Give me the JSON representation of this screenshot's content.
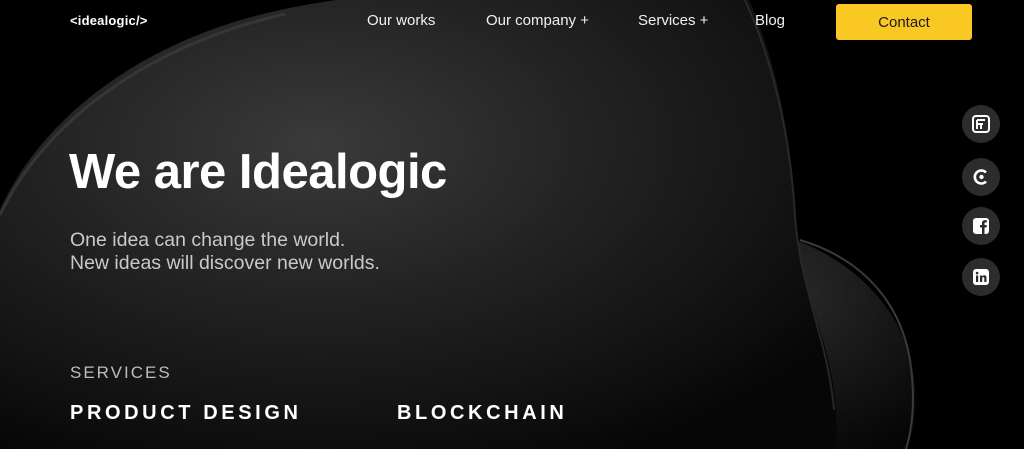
{
  "header": {
    "logo": "<idealogic/>",
    "nav": [
      {
        "label": "Our works"
      },
      {
        "label": "Our company +"
      },
      {
        "label": "Services +"
      },
      {
        "label": "Blog"
      }
    ],
    "contact_label": "Contact"
  },
  "hero": {
    "title": "We are Idealogic",
    "subtitle_line1": "One idea can change the world.",
    "subtitle_line2": "New ideas will discover new worlds."
  },
  "services": {
    "label": "SERVICES",
    "items": [
      "PRODUCT DESIGN",
      "BLOCKCHAIN"
    ]
  },
  "social": [
    {
      "icon": "forbes-icon"
    },
    {
      "icon": "clutch-icon"
    },
    {
      "icon": "facebook-icon"
    },
    {
      "icon": "linkedin-icon"
    }
  ],
  "colors": {
    "background": "#000000",
    "accent": "#f9c823",
    "social_bg": "#2c2c2c"
  }
}
